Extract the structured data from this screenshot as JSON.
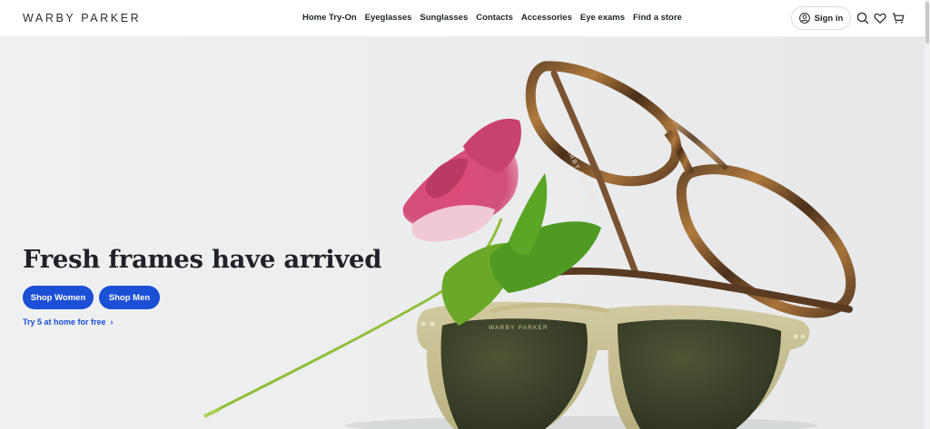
{
  "brand": {
    "logo_text": "WARBY PARKER"
  },
  "nav": {
    "items": [
      {
        "label": "Home Try-On"
      },
      {
        "label": "Eyeglasses"
      },
      {
        "label": "Sunglasses"
      },
      {
        "label": "Contacts"
      },
      {
        "label": "Accessories"
      },
      {
        "label": "Eye exams"
      },
      {
        "label": "Find a store"
      }
    ]
  },
  "header_actions": {
    "signin_label": "Sign in",
    "icons": [
      "user-icon",
      "search-icon",
      "heart-icon",
      "cart-icon"
    ]
  },
  "hero": {
    "headline": "Fresh frames have arrived",
    "buttons": {
      "women": "Shop Women",
      "men": "Shop Men"
    },
    "link": "Try 5 at home for free",
    "frame_imprint": "WARBY PARKER",
    "colors": {
      "primary_blue": "#1a4fd6",
      "background": "#eceef0"
    }
  }
}
